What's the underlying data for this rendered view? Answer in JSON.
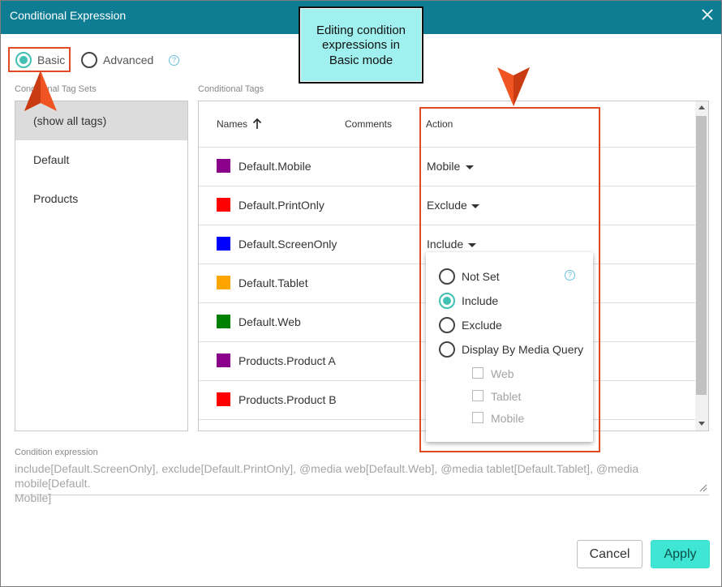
{
  "window": {
    "title": "Conditional Expression"
  },
  "mode": {
    "basic_label": "Basic",
    "advanced_label": "Advanced",
    "selected": "Basic"
  },
  "callout": {
    "line1": "Editing condition",
    "line2": "expressions in",
    "line3": "Basic mode"
  },
  "tag_sets": {
    "label": "Conditional Tag Sets",
    "items": [
      {
        "label": "(show all tags)",
        "selected": true
      },
      {
        "label": "Default",
        "selected": false
      },
      {
        "label": "Products",
        "selected": false
      }
    ]
  },
  "tags": {
    "label": "Conditional Tags",
    "columns": {
      "names": "Names",
      "comments": "Comments",
      "action": "Action"
    },
    "rows": [
      {
        "name": "Default.Mobile",
        "color": "#8b008b",
        "action": "Mobile"
      },
      {
        "name": "Default.PrintOnly",
        "color": "#ff0000",
        "action": "Exclude"
      },
      {
        "name": "Default.ScreenOnly",
        "color": "#0000ff",
        "action": "Include"
      },
      {
        "name": "Default.Tablet",
        "color": "#ffa500",
        "action": ""
      },
      {
        "name": "Default.Web",
        "color": "#008000",
        "action": ""
      },
      {
        "name": "Products.Product A",
        "color": "#8b008b",
        "action": ""
      },
      {
        "name": "Products.Product B",
        "color": "#ff0000",
        "action": ""
      }
    ]
  },
  "action_menu": {
    "options": [
      {
        "label": "Not Set",
        "selected": false
      },
      {
        "label": "Include",
        "selected": true
      },
      {
        "label": "Exclude",
        "selected": false
      },
      {
        "label": "Display By Media Query",
        "selected": false
      }
    ],
    "media": [
      {
        "label": "Web",
        "checked": false
      },
      {
        "label": "Tablet",
        "checked": false
      },
      {
        "label": "Mobile",
        "checked": false
      }
    ]
  },
  "condition": {
    "label": "Condition expression",
    "line1": "include[Default.ScreenOnly], exclude[Default.PrintOnly], @media web[Default.Web], @media tablet[Default.Tablet], @media mobile[Default.",
    "line2": "Mobile]"
  },
  "buttons": {
    "cancel": "Cancel",
    "apply": "Apply"
  },
  "colors": {
    "titlebar": "#0e7d93",
    "accent": "#41c0b3",
    "highlight": "#e04a24",
    "callout": "#9ff0ee",
    "apply": "#3ee6d3"
  }
}
